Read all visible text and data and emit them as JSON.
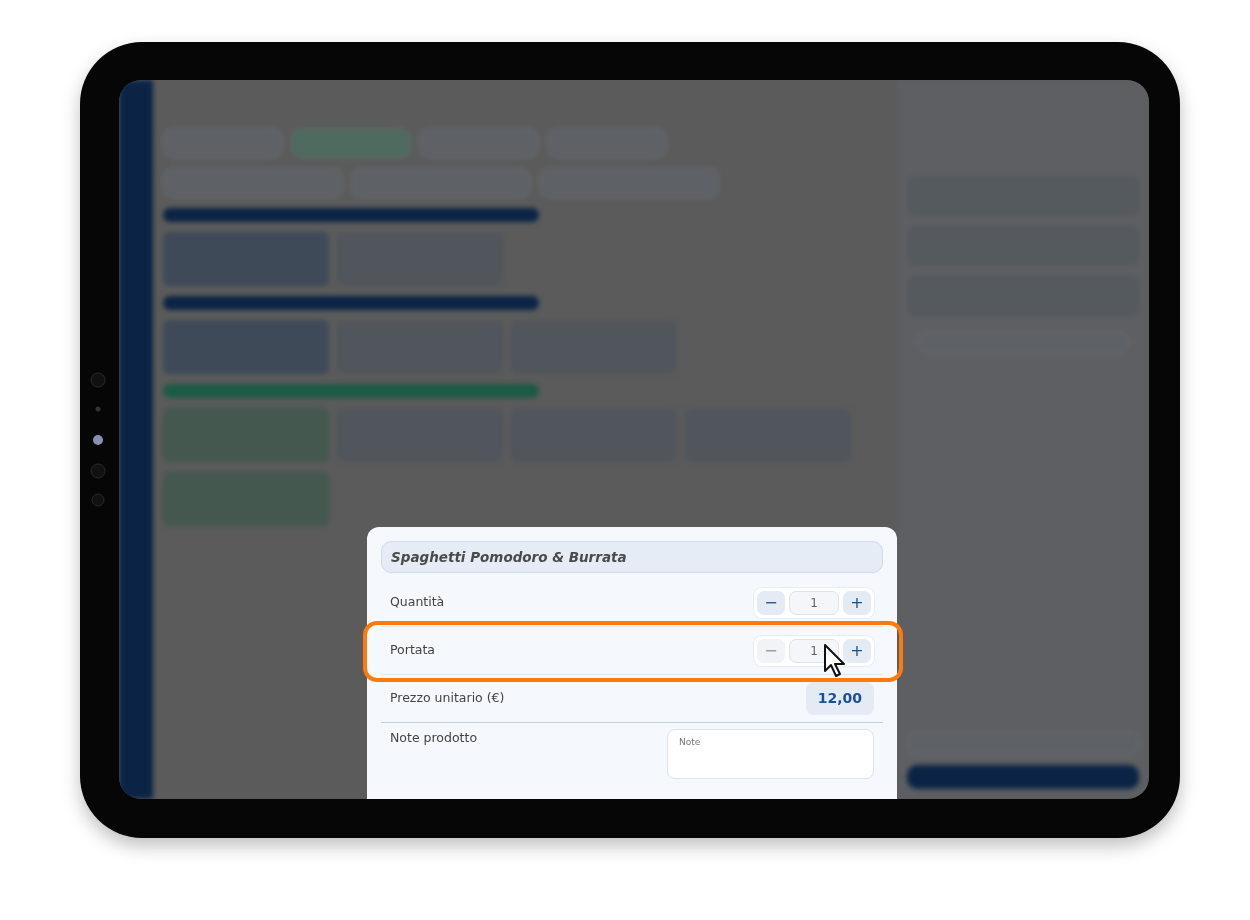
{
  "dialog": {
    "title": "Spaghetti Pomodoro & Burrata",
    "rows": [
      {
        "kind": "stepper",
        "label": "Quantità",
        "value": "1",
        "minus": "−",
        "plus": "+",
        "minus_disabled": false,
        "highlighted": false
      },
      {
        "kind": "stepper",
        "label": "Portata",
        "value": "1",
        "minus": "−",
        "plus": "+",
        "minus_disabled": true,
        "highlighted": true
      },
      {
        "kind": "price",
        "label": "Prezzo unitario (€)",
        "value": "12,00"
      },
      {
        "kind": "note",
        "label": "Note prodotto",
        "placeholder": "Note"
      }
    ]
  }
}
